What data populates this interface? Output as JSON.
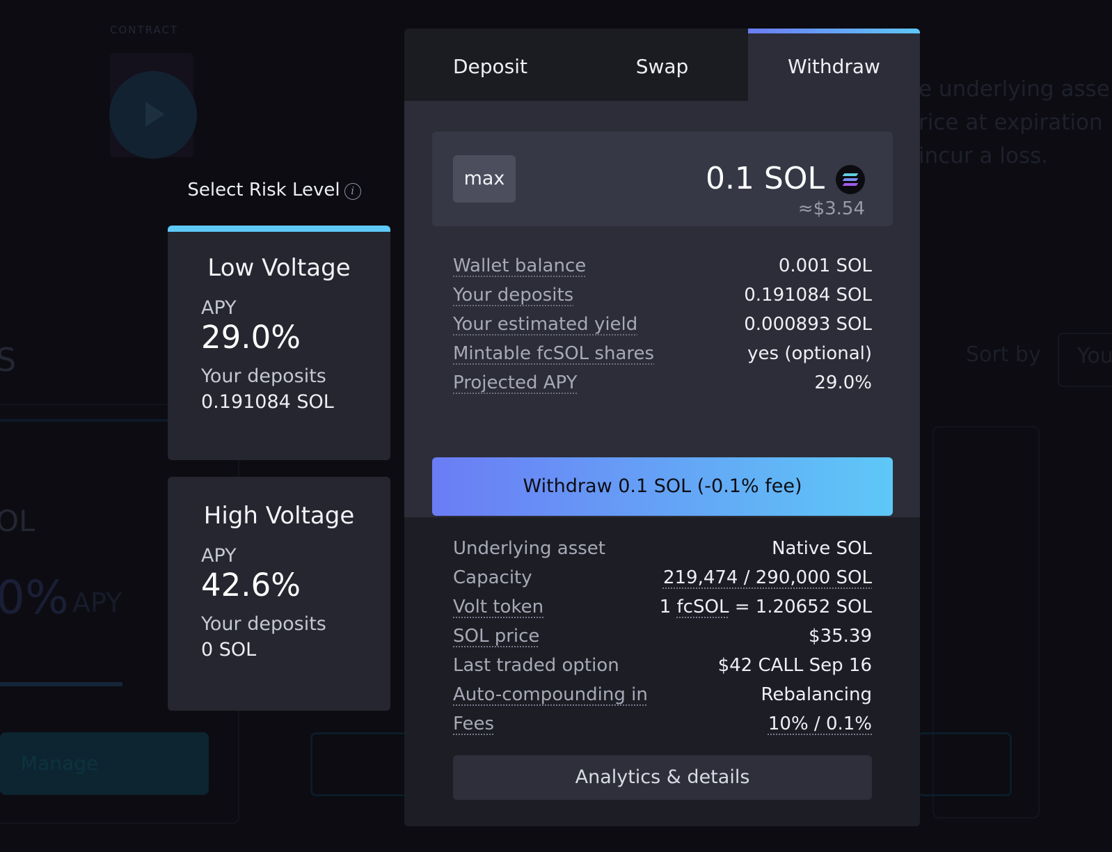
{
  "background": {
    "contract_label": "CONTRACT",
    "right_text": [
      "e underlying asse",
      "rice at expiration",
      "incur a loss."
    ],
    "sort_by": "Sort by",
    "sort_value": "You",
    "big_letter": "S",
    "token_fragment": "OL",
    "apy_fragment": "0%",
    "apy_label": "APY",
    "manage_label": "Manage"
  },
  "risk": {
    "header": "Select Risk Level",
    "cards": [
      {
        "title": "Low Voltage",
        "apy_label": "APY",
        "apy": "29.0%",
        "deposits_label": "Your deposits",
        "deposits": "0.191084 SOL"
      },
      {
        "title": "High Voltage",
        "apy_label": "APY",
        "apy": "42.6%",
        "deposits_label": "Your deposits",
        "deposits": "0 SOL"
      }
    ]
  },
  "tabs": [
    {
      "label": "Deposit"
    },
    {
      "label": "Swap"
    },
    {
      "label": "Withdraw",
      "active": true
    }
  ],
  "amount": {
    "max_label": "max",
    "value": "0.1 SOL",
    "usd": "≈$3.54",
    "token_icon": "solana-icon"
  },
  "info": [
    {
      "label": "Wallet balance",
      "value": "0.001 SOL"
    },
    {
      "label": "Your deposits",
      "value": "0.191084 SOL"
    },
    {
      "label": "Your estimated yield",
      "value": "0.000893 SOL"
    },
    {
      "label": "Mintable fcSOL shares",
      "value": "yes (optional)"
    },
    {
      "label": "Projected APY",
      "value": "29.0%"
    }
  ],
  "withdraw_button": "Withdraw 0.1 SOL (-0.1% fee)",
  "details": {
    "underlying_label": "Underlying asset",
    "underlying_value": "Native SOL",
    "capacity_label": "Capacity",
    "capacity_value": "219,474 / 290,000 SOL",
    "volt_label": "Volt token",
    "volt_prefix": "1",
    "volt_token": "fcSOL",
    "volt_suffix": "= 1.20652 SOL",
    "price_label": "SOL price",
    "price_value": "$35.39",
    "option_label": "Last traded option",
    "option_value": "$42 CALL Sep 16",
    "compound_label": "Auto-compounding in",
    "compound_value": "Rebalancing",
    "fees_label": "Fees",
    "fees_value": "10% / 0.1%"
  },
  "analytics_button": "Analytics & details",
  "colors": {
    "accent_start": "#6b7cf5",
    "accent_end": "#5ec8f7",
    "panel": "#2c2d38"
  }
}
